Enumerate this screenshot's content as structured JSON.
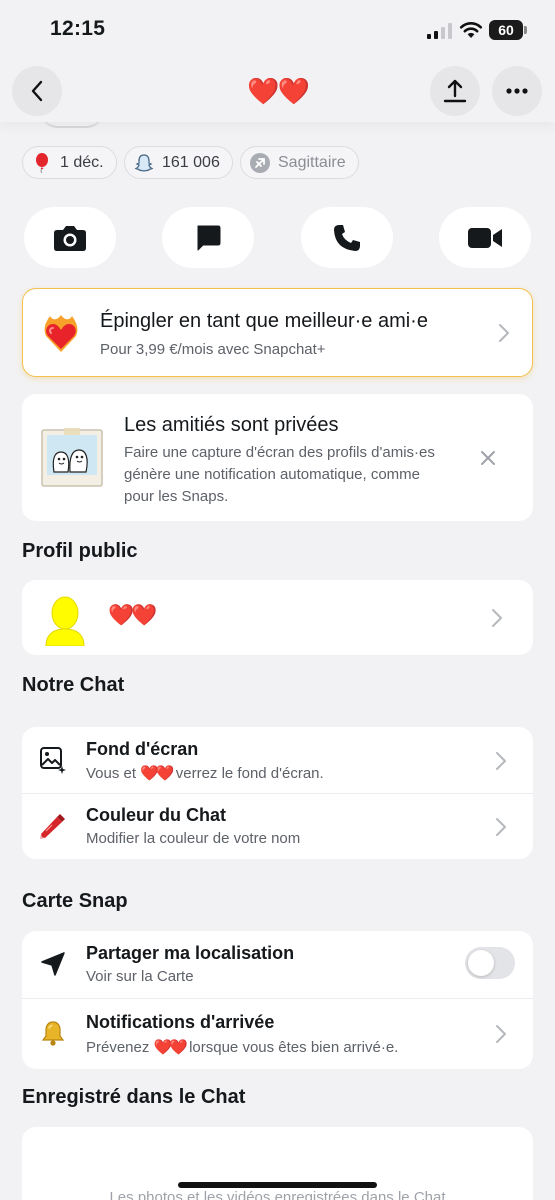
{
  "status_bar": {
    "time": "12:15",
    "battery": "60"
  },
  "header": {
    "title": "❤️❤️"
  },
  "chips": [
    {
      "icon": "balloon-icon",
      "label": "1 déc."
    },
    {
      "icon": "snapchat-ghost-icon",
      "label": "161 006"
    },
    {
      "icon": "sagittarius-icon",
      "label": "Sagittaire"
    }
  ],
  "actions": [
    "camera-icon",
    "chat-bubble-icon",
    "phone-icon",
    "video-camera-icon"
  ],
  "bff": {
    "title": "Épingler en tant que meilleur·e ami·e",
    "subtitle": "Pour 3,99 €/mois avec Snapchat+"
  },
  "privacy": {
    "title": "Les amitiés sont privées",
    "body": "Faire une capture d'écran des profils d'amis·es génère une notification automatique, comme pour les Snaps."
  },
  "public_profile": {
    "section_title": "Profil public",
    "name": "❤️❤️"
  },
  "our_chat": {
    "section_title": "Notre Chat",
    "wallpaper": {
      "title": "Fond d'écran",
      "sub_prefix": "Vous et",
      "sub_name": "❤️❤️",
      "sub_suffix": "verrez le fond d'écran."
    },
    "chat_color": {
      "title": "Couleur du Chat",
      "subtitle": "Modifier la couleur de votre nom"
    }
  },
  "snap_map": {
    "section_title": "Carte Snap",
    "share_location": {
      "title": "Partager ma localisation",
      "subtitle": "Voir sur la Carte",
      "enabled": false
    },
    "arrival": {
      "title": "Notifications d'arrivée",
      "sub_prefix": "Prévenez",
      "sub_name": "❤️❤️",
      "sub_suffix": "lorsque vous êtes bien arrivé·e."
    }
  },
  "saved": {
    "section_title": "Enregistré dans le Chat",
    "text": "Les photos et les vidéos enregistrées dans le Chat"
  },
  "colors": {
    "accent_red": "#e0201c",
    "gold_border": "#f2c14e",
    "bitmoji_yellow": "#fffc00"
  }
}
